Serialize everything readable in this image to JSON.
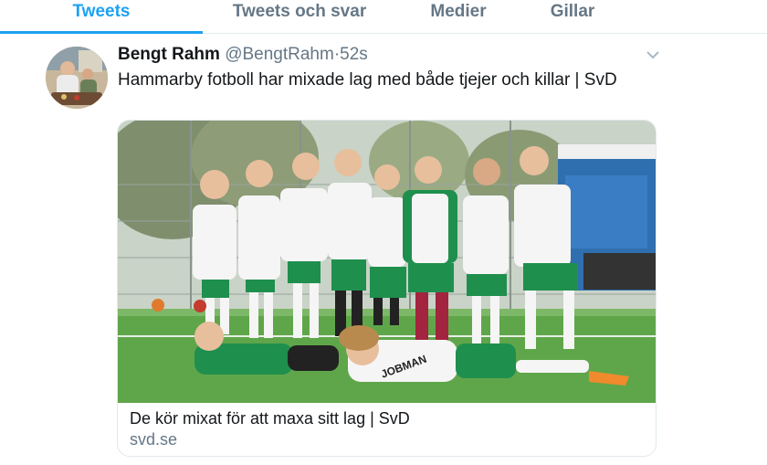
{
  "tabs": [
    {
      "label": "Tweets",
      "active": true
    },
    {
      "label": "Tweets och svar",
      "active": false
    },
    {
      "label": "Medier",
      "active": false
    },
    {
      "label": "Gillar",
      "active": false
    }
  ],
  "tweet": {
    "author_name": "Bengt Rahm",
    "author_handle": "@BengtRahm",
    "separator": "·",
    "timestamp": "52s",
    "text": "Hammarby fotboll har mixade lag med både tjejer och killar | SvD",
    "menu_icon": "chevron-down-icon"
  },
  "card": {
    "title": "De kör mixat för att maxa sitt lag | SvD",
    "domain": "svd.se",
    "image_label": "JOBMAN"
  },
  "colors": {
    "accent": "#1da1f2",
    "muted": "#657786",
    "jersey_green": "#1f8f4e"
  }
}
